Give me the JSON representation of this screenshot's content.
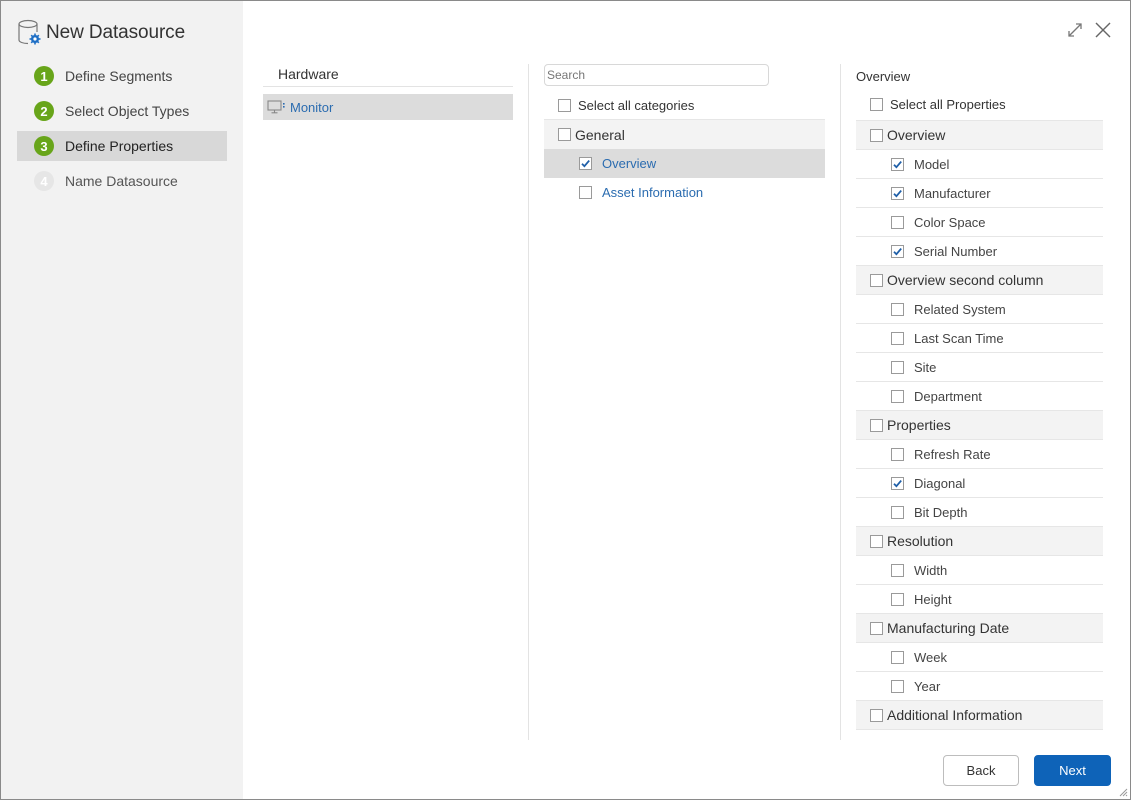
{
  "sidebar": {
    "title": "New Datasource",
    "steps": [
      {
        "number": "1",
        "label": "Define Segments",
        "state": "complete"
      },
      {
        "number": "2",
        "label": "Select Object Types",
        "state": "complete"
      },
      {
        "number": "3",
        "label": "Define Properties",
        "state": "active"
      },
      {
        "number": "4",
        "label": "Name Datasource",
        "state": "disabled"
      }
    ]
  },
  "window_controls": {
    "expand_icon": "expand-icon",
    "close_icon": "close-icon"
  },
  "object_types": {
    "header": "Hardware",
    "items": [
      {
        "label": "Monitor",
        "icon": "monitor-icon",
        "selected": true
      }
    ]
  },
  "categories": {
    "search_placeholder": "Search",
    "search_value": "",
    "select_all_label": "Select all categories",
    "select_all_checked": false,
    "groups": [
      {
        "label": "General",
        "checked": false,
        "items": [
          {
            "label": "Overview",
            "checked": true,
            "selected": true
          },
          {
            "label": "Asset Information",
            "checked": false,
            "selected": false
          }
        ]
      }
    ]
  },
  "properties": {
    "header": "Overview",
    "select_all_label": "Select all Properties",
    "select_all_checked": false,
    "groups": [
      {
        "label": "Overview",
        "checked": false,
        "items": [
          {
            "label": "Model",
            "checked": true
          },
          {
            "label": "Manufacturer",
            "checked": true
          },
          {
            "label": "Color Space",
            "checked": false
          },
          {
            "label": "Serial Number",
            "checked": true
          }
        ]
      },
      {
        "label": "Overview second column",
        "checked": false,
        "items": [
          {
            "label": "Related System",
            "checked": false
          },
          {
            "label": "Last Scan Time",
            "checked": false
          },
          {
            "label": "Site",
            "checked": false
          },
          {
            "label": "Department",
            "checked": false
          }
        ]
      },
      {
        "label": "Properties",
        "checked": false,
        "items": [
          {
            "label": "Refresh Rate",
            "checked": false
          },
          {
            "label": "Diagonal",
            "checked": true
          },
          {
            "label": "Bit Depth",
            "checked": false
          }
        ]
      },
      {
        "label": "Resolution",
        "checked": false,
        "items": [
          {
            "label": "Width",
            "checked": false
          },
          {
            "label": "Height",
            "checked": false
          }
        ]
      },
      {
        "label": "Manufacturing Date",
        "checked": false,
        "items": [
          {
            "label": "Week",
            "checked": false
          },
          {
            "label": "Year",
            "checked": false
          }
        ]
      },
      {
        "label": "Additional Information",
        "checked": false,
        "items": []
      }
    ]
  },
  "footer": {
    "back_label": "Back",
    "next_label": "Next"
  },
  "colors": {
    "accent_blue": "#0e63b8",
    "link_blue": "#2b6cb0",
    "step_green": "#68a51a",
    "check_blue": "#1f5fa8"
  }
}
